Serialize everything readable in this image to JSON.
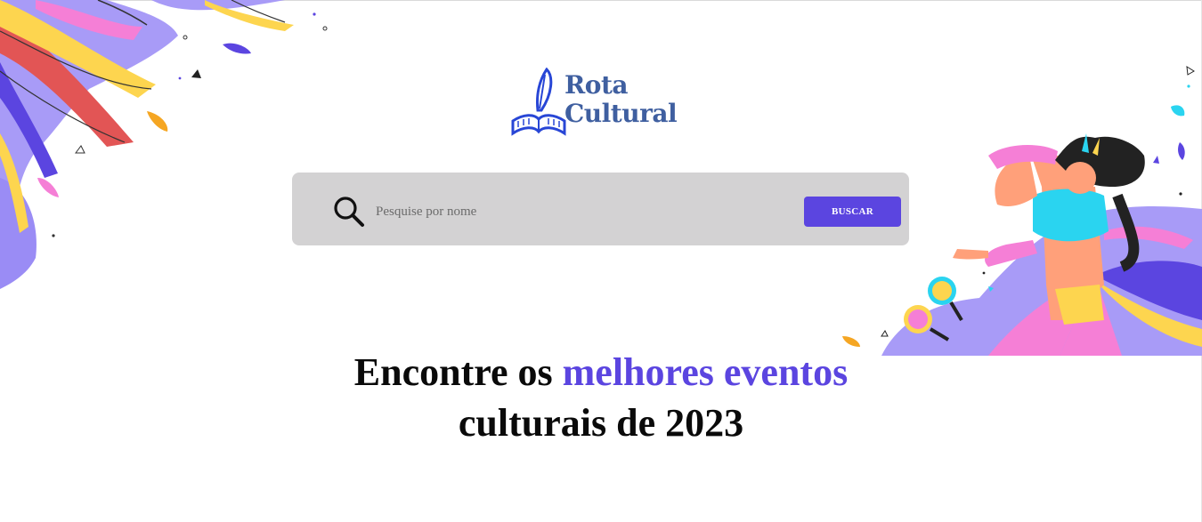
{
  "logo": {
    "line1": "Rota",
    "line2": "Cultural",
    "icon": "quill-book-icon"
  },
  "search": {
    "icon": "search-icon",
    "placeholder": "Pesquise por nome",
    "value": "",
    "button_label": "BUSCAR"
  },
  "headline": {
    "part1": "Encontre os ",
    "accent": "melhores eventos",
    "line2": "culturais de 2023"
  },
  "colors": {
    "accent": "#5b45e0",
    "logo": "#3f5fa0",
    "search_bg": "#d3d2d3"
  }
}
